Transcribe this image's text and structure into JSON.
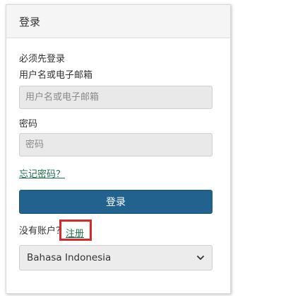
{
  "header": {
    "title": "登录"
  },
  "form": {
    "notice": "必须先登录",
    "username_label": "用户名或电子邮箱",
    "username_placeholder": "用户名或电子邮箱",
    "password_label": "密码",
    "password_placeholder": "密码",
    "forgot_link": "忘记密码？",
    "login_button": "登录",
    "no_account_text": "没有账户？",
    "register_link": "注册"
  },
  "language": {
    "selected": "Bahasa Indonesia"
  },
  "colors": {
    "primary": "#21628f",
    "link": "#1f6f50",
    "highlight": "#d42a2a"
  },
  "icons": {
    "select_arrow": "chevron-down-icon"
  }
}
